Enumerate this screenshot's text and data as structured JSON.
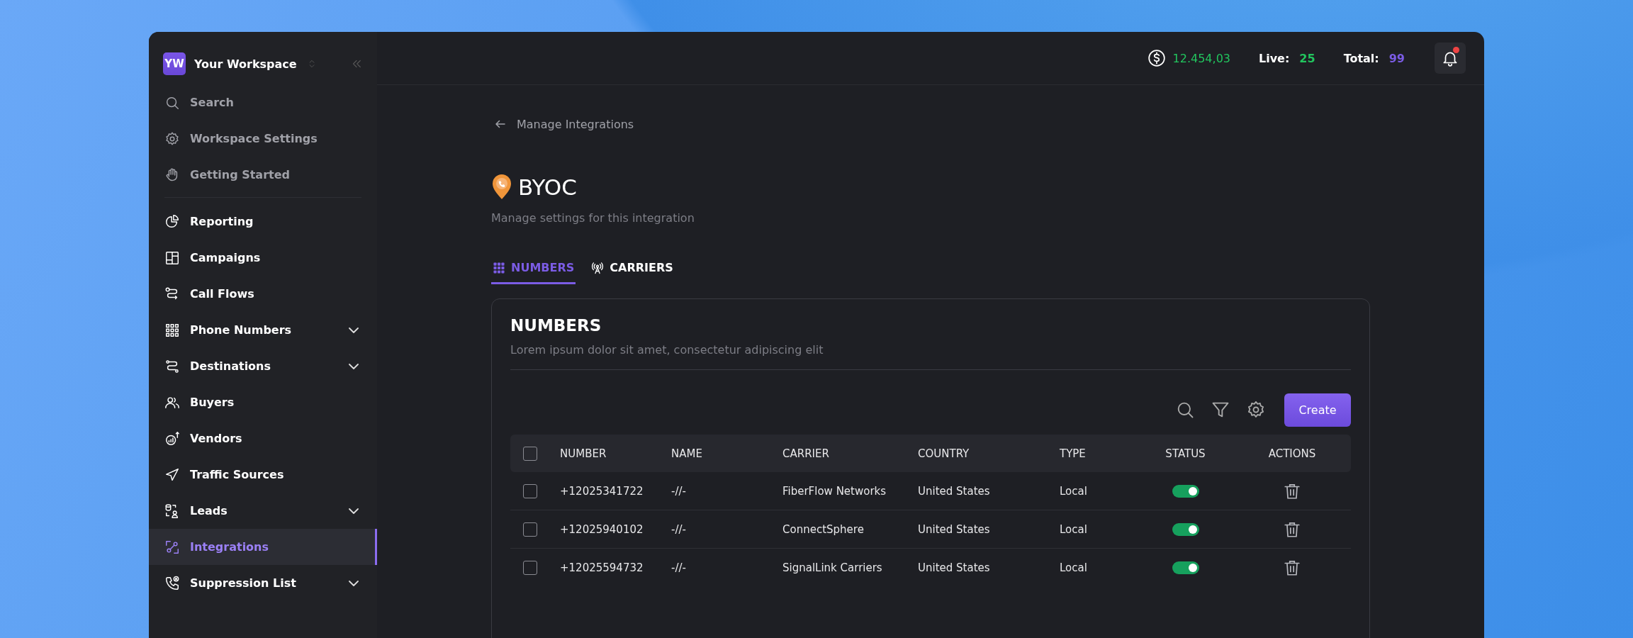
{
  "workspace": {
    "initials": "YW",
    "name": "Your Workspace"
  },
  "sidebar": {
    "top_items": [
      {
        "label": "Search"
      },
      {
        "label": "Workspace Settings"
      },
      {
        "label": "Getting Started"
      }
    ],
    "items": [
      {
        "label": "Reporting",
        "expandable": false,
        "selected": false
      },
      {
        "label": "Campaigns",
        "expandable": false,
        "selected": false
      },
      {
        "label": "Call Flows",
        "expandable": false,
        "selected": false
      },
      {
        "label": "Phone Numbers",
        "expandable": true,
        "selected": false
      },
      {
        "label": "Destinations",
        "expandable": true,
        "selected": false
      },
      {
        "label": "Buyers",
        "expandable": false,
        "selected": false
      },
      {
        "label": "Vendors",
        "expandable": false,
        "selected": false
      },
      {
        "label": "Traffic Sources",
        "expandable": false,
        "selected": false
      },
      {
        "label": "Leads",
        "expandable": true,
        "selected": false
      },
      {
        "label": "Integrations",
        "expandable": false,
        "selected": true
      },
      {
        "label": "Suppression List",
        "expandable": true,
        "selected": false
      }
    ]
  },
  "topbar": {
    "balance": "12.454,03",
    "live_label": "Live:",
    "live_value": "25",
    "total_label": "Total:",
    "total_value": "99",
    "unread_notifications": true
  },
  "breadcrumb": "Manage Integrations",
  "title": "BYOC",
  "subtitle": "Manage settings for this integration",
  "tabs": [
    {
      "label": "NUMBERS",
      "selected": true
    },
    {
      "label": "CARRIERS",
      "selected": false
    }
  ],
  "card": {
    "title": "NUMBERS",
    "description": "Lorem ipsum dolor sit amet, consectetur adipiscing elit",
    "create_button": "Create",
    "all_checked": false,
    "columns": [
      "NUMBER",
      "NAME",
      "CARRIER",
      "COUNTRY",
      "TYPE",
      "STATUS",
      "ACTIONS"
    ],
    "rows": [
      {
        "checked": false,
        "number": "+12025341722",
        "name": "-//-",
        "carrier": "FiberFlow Networks",
        "country": "United States",
        "type": "Local",
        "on": true
      },
      {
        "checked": false,
        "number": "+12025940102",
        "name": "-//-",
        "carrier": "ConnectSphere",
        "country": "United States",
        "type": "Local",
        "on": true
      },
      {
        "checked": false,
        "number": "+12025594732",
        "name": "-//-",
        "carrier": "SignalLink Carriers",
        "country": "United States",
        "type": "Local",
        "on": true
      }
    ]
  }
}
